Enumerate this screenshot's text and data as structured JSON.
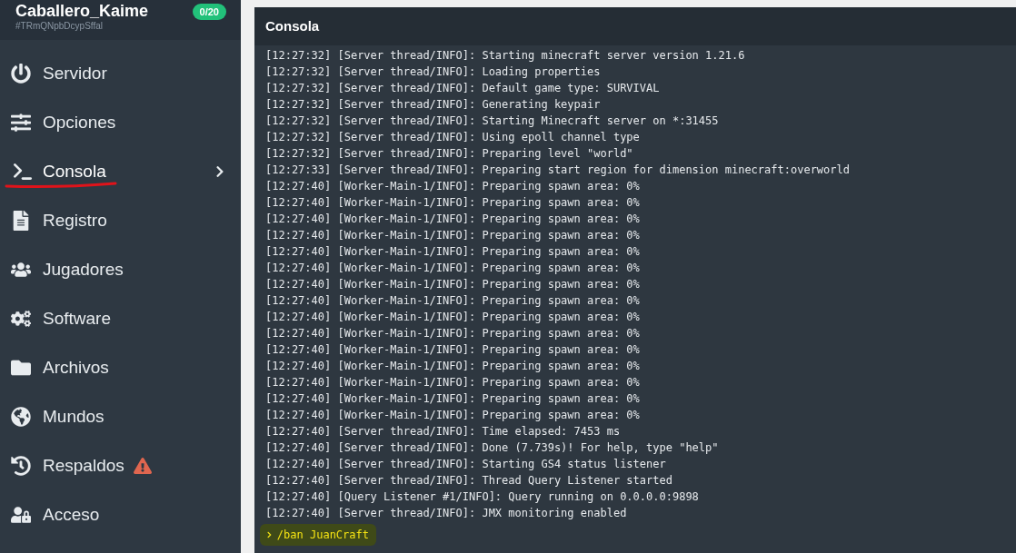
{
  "server": {
    "name": "Caballero_Kaime",
    "id": "#TRmQNpbDcypSffal",
    "players": "0/20"
  },
  "nav": [
    {
      "label": "Servidor",
      "selected": false,
      "warning": false
    },
    {
      "label": "Opciones",
      "selected": false,
      "warning": false
    },
    {
      "label": "Consola",
      "selected": true,
      "warning": false
    },
    {
      "label": "Registro",
      "selected": false,
      "warning": false
    },
    {
      "label": "Jugadores",
      "selected": false,
      "warning": false
    },
    {
      "label": "Software",
      "selected": false,
      "warning": false
    },
    {
      "label": "Archivos",
      "selected": false,
      "warning": false
    },
    {
      "label": "Mundos",
      "selected": false,
      "warning": false
    },
    {
      "label": "Respaldos",
      "selected": false,
      "warning": true
    },
    {
      "label": "Acceso",
      "selected": false,
      "warning": false
    }
  ],
  "console": {
    "title": "Consola",
    "lines": [
      "[12:27:32] [Server thread/INFO]: Starting minecraft server version 1.21.6",
      "[12:27:32] [Server thread/INFO]: Loading properties",
      "[12:27:32] [Server thread/INFO]: Default game type: SURVIVAL",
      "[12:27:32] [Server thread/INFO]: Generating keypair",
      "[12:27:32] [Server thread/INFO]: Starting Minecraft server on *:31455",
      "[12:27:32] [Server thread/INFO]: Using epoll channel type",
      "[12:27:32] [Server thread/INFO]: Preparing level \"world\"",
      "[12:27:33] [Server thread/INFO]: Preparing start region for dimension minecraft:overworld",
      "[12:27:40] [Worker-Main-1/INFO]: Preparing spawn area: 0%",
      "[12:27:40] [Worker-Main-1/INFO]: Preparing spawn area: 0%",
      "[12:27:40] [Worker-Main-1/INFO]: Preparing spawn area: 0%",
      "[12:27:40] [Worker-Main-1/INFO]: Preparing spawn area: 0%",
      "[12:27:40] [Worker-Main-1/INFO]: Preparing spawn area: 0%",
      "[12:27:40] [Worker-Main-1/INFO]: Preparing spawn area: 0%",
      "[12:27:40] [Worker-Main-1/INFO]: Preparing spawn area: 0%",
      "[12:27:40] [Worker-Main-1/INFO]: Preparing spawn area: 0%",
      "[12:27:40] [Worker-Main-1/INFO]: Preparing spawn area: 0%",
      "[12:27:40] [Worker-Main-1/INFO]: Preparing spawn area: 0%",
      "[12:27:40] [Worker-Main-1/INFO]: Preparing spawn area: 0%",
      "[12:27:40] [Worker-Main-1/INFO]: Preparing spawn area: 0%",
      "[12:27:40] [Worker-Main-1/INFO]: Preparing spawn area: 0%",
      "[12:27:40] [Worker-Main-1/INFO]: Preparing spawn area: 0%",
      "[12:27:40] [Worker-Main-1/INFO]: Preparing spawn area: 0%",
      "[12:27:40] [Server thread/INFO]: Time elapsed: 7453 ms",
      "[12:27:40] [Server thread/INFO]: Done (7.739s)! For help, type \"help\"",
      "[12:27:40] [Server thread/INFO]: Starting GS4 status listener",
      "[12:27:40] [Server thread/INFO]: Thread Query Listener started",
      "[12:27:40] [Query Listener #1/INFO]: Query running on 0.0.0.0:9898",
      "[12:27:40] [Server thread/INFO]: JMX monitoring enabled"
    ],
    "command": "/ban JuanCraft"
  }
}
